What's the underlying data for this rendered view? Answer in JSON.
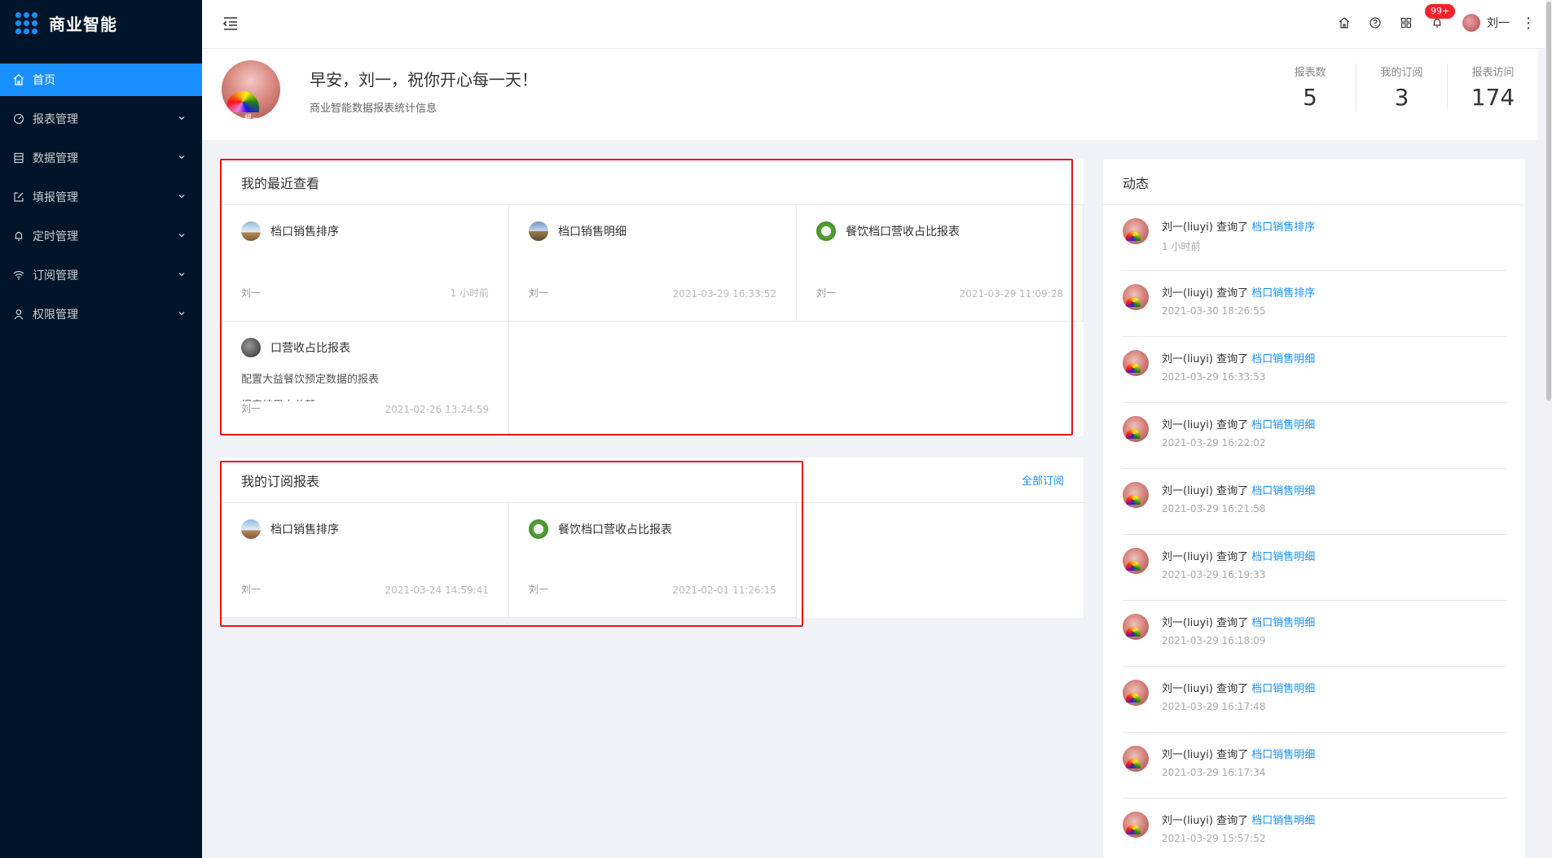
{
  "app": {
    "title": "商业智能"
  },
  "sidebar": {
    "items": [
      {
        "label": "首页",
        "icon": "home-icon"
      },
      {
        "label": "报表管理",
        "icon": "dashboard-icon"
      },
      {
        "label": "数据管理",
        "icon": "database-icon"
      },
      {
        "label": "填报管理",
        "icon": "edit-icon"
      },
      {
        "label": "定时管理",
        "icon": "bell-icon"
      },
      {
        "label": "订阅管理",
        "icon": "wifi-icon"
      },
      {
        "label": "权限管理",
        "icon": "user-icon"
      }
    ]
  },
  "header": {
    "notification_badge": "99+",
    "user_name": "刘一"
  },
  "welcome": {
    "avatar_caption": "暖~",
    "greeting": "早安，刘一，祝你开心每一天！",
    "subtitle": "商业智能数据报表统计信息",
    "stats": [
      {
        "label": "报表数",
        "value": "5"
      },
      {
        "label": "我的订阅",
        "value": "3"
      },
      {
        "label": "报表访问",
        "value": "174"
      }
    ]
  },
  "recent": {
    "title": "我的最近查看",
    "items": [
      {
        "name": "档口销售排序",
        "user": "刘一",
        "time": "1 小时前",
        "icon": "ic-sky"
      },
      {
        "name": "档口销售明细",
        "user": "刘一",
        "time": "2021-03-29 16:33:52",
        "icon": "ic-road"
      },
      {
        "name": "餐饮档口营收占比报表",
        "user": "刘一",
        "time": "2021-03-29 11:09:28",
        "icon": "ic-leaf"
      },
      {
        "name": "口营收占比报表",
        "desc": "配置大益餐饮预定数据的报表",
        "desc2": "报表结果占总额",
        "user": "刘一",
        "time": "2021-02-26 13:24:59",
        "icon": "ic-dark"
      }
    ]
  },
  "subscriptions": {
    "title": "我的订阅报表",
    "extra": "全部订阅",
    "items": [
      {
        "name": "档口销售排序",
        "user": "刘一",
        "time": "2021-03-24 14:59:41",
        "icon": "ic-sky"
      },
      {
        "name": "餐饮档口营收占比报表",
        "user": "刘一",
        "time": "2021-02-01 11:26:15",
        "icon": "ic-leaf"
      }
    ]
  },
  "activity": {
    "title": "动态",
    "items": [
      {
        "who": "刘一(liuyi)",
        "verb": "查询了",
        "target": "档口销售排序",
        "time": "1 小时前"
      },
      {
        "who": "刘一(liuyi)",
        "verb": "查询了",
        "target": "档口销售排序",
        "time": "2021-03-30 18:26:55"
      },
      {
        "who": "刘一(liuyi)",
        "verb": "查询了",
        "target": "档口销售明细",
        "time": "2021-03-29 16:33:53"
      },
      {
        "who": "刘一(liuyi)",
        "verb": "查询了",
        "target": "档口销售明细",
        "time": "2021-03-29 16:22:02"
      },
      {
        "who": "刘一(liuyi)",
        "verb": "查询了",
        "target": "档口销售明细",
        "time": "2021-03-29 16:21:58"
      },
      {
        "who": "刘一(liuyi)",
        "verb": "查询了",
        "target": "档口销售明细",
        "time": "2021-03-29 16:19:33"
      },
      {
        "who": "刘一(liuyi)",
        "verb": "查询了",
        "target": "档口销售明细",
        "time": "2021-03-29 16:18:09"
      },
      {
        "who": "刘一(liuyi)",
        "verb": "查询了",
        "target": "档口销售明细",
        "time": "2021-03-29 16:17:48"
      },
      {
        "who": "刘一(liuyi)",
        "verb": "查询了",
        "target": "档口销售明细",
        "time": "2021-03-29 16:17:34"
      },
      {
        "who": "刘一(liuyi)",
        "verb": "查询了",
        "target": "档口销售明细",
        "time": "2021-03-29 15:57:52"
      }
    ]
  },
  "colors": {
    "primary": "#1890ff",
    "sidebar_bg": "#001529",
    "highlight_box": "#e8141a"
  }
}
